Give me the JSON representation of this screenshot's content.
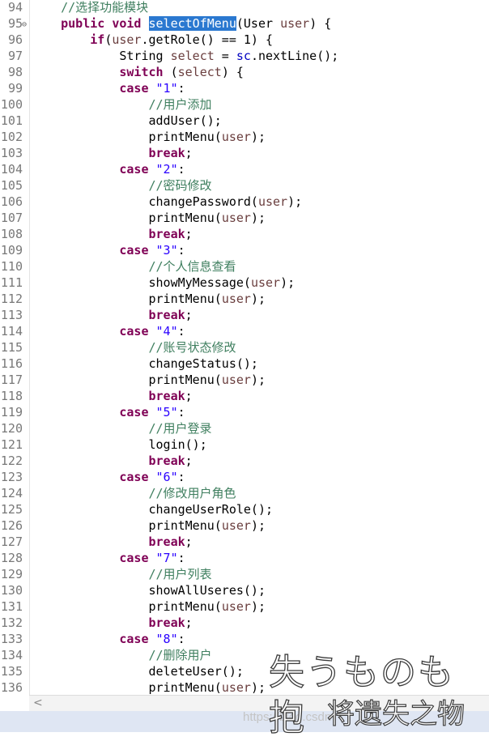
{
  "editor": {
    "lines": [
      {
        "num": "94",
        "fold": "",
        "tokens": [
          {
            "t": "    "
          },
          {
            "t": "//选择功能模块",
            "c": "com"
          }
        ]
      },
      {
        "num": "95",
        "fold": "⊖",
        "tokens": [
          {
            "t": "    "
          },
          {
            "t": "public",
            "c": "kw"
          },
          {
            "t": " "
          },
          {
            "t": "void",
            "c": "kw"
          },
          {
            "t": " "
          },
          {
            "t": "selectOfMenu",
            "c": "sel"
          },
          {
            "t": "(User "
          },
          {
            "t": "user",
            "c": "var"
          },
          {
            "t": ") {"
          }
        ]
      },
      {
        "num": "96",
        "fold": "",
        "tokens": [
          {
            "t": "        "
          },
          {
            "t": "if",
            "c": "kw"
          },
          {
            "t": "("
          },
          {
            "t": "user",
            "c": "var"
          },
          {
            "t": ".getRole() == 1) {"
          }
        ]
      },
      {
        "num": "97",
        "fold": "",
        "tokens": [
          {
            "t": "            String "
          },
          {
            "t": "select",
            "c": "var"
          },
          {
            "t": " = "
          },
          {
            "t": "sc",
            "c": "fld"
          },
          {
            "t": ".nextLine();"
          }
        ]
      },
      {
        "num": "98",
        "fold": "",
        "tokens": [
          {
            "t": "            "
          },
          {
            "t": "switch",
            "c": "kw"
          },
          {
            "t": " ("
          },
          {
            "t": "select",
            "c": "var"
          },
          {
            "t": ") {"
          }
        ]
      },
      {
        "num": "99",
        "fold": "",
        "tokens": [
          {
            "t": "            "
          },
          {
            "t": "case",
            "c": "kw"
          },
          {
            "t": " "
          },
          {
            "t": "\"1\"",
            "c": "str"
          },
          {
            "t": ":"
          }
        ]
      },
      {
        "num": "100",
        "fold": "",
        "tokens": [
          {
            "t": "                "
          },
          {
            "t": "//用户添加",
            "c": "com"
          }
        ]
      },
      {
        "num": "101",
        "fold": "",
        "tokens": [
          {
            "t": "                addUser();"
          }
        ]
      },
      {
        "num": "102",
        "fold": "",
        "tokens": [
          {
            "t": "                printMenu("
          },
          {
            "t": "user",
            "c": "var"
          },
          {
            "t": ");"
          }
        ]
      },
      {
        "num": "103",
        "fold": "",
        "tokens": [
          {
            "t": "                "
          },
          {
            "t": "break",
            "c": "kw"
          },
          {
            "t": ";"
          }
        ]
      },
      {
        "num": "104",
        "fold": "",
        "tokens": [
          {
            "t": "            "
          },
          {
            "t": "case",
            "c": "kw"
          },
          {
            "t": " "
          },
          {
            "t": "\"2\"",
            "c": "str"
          },
          {
            "t": ":"
          }
        ]
      },
      {
        "num": "105",
        "fold": "",
        "tokens": [
          {
            "t": "                "
          },
          {
            "t": "//密码修改",
            "c": "com"
          }
        ]
      },
      {
        "num": "106",
        "fold": "",
        "tokens": [
          {
            "t": "                changePassword("
          },
          {
            "t": "user",
            "c": "var"
          },
          {
            "t": ");"
          }
        ]
      },
      {
        "num": "107",
        "fold": "",
        "tokens": [
          {
            "t": "                printMenu("
          },
          {
            "t": "user",
            "c": "var"
          },
          {
            "t": ");"
          }
        ]
      },
      {
        "num": "108",
        "fold": "",
        "tokens": [
          {
            "t": "                "
          },
          {
            "t": "break",
            "c": "kw"
          },
          {
            "t": ";"
          }
        ]
      },
      {
        "num": "109",
        "fold": "",
        "tokens": [
          {
            "t": "            "
          },
          {
            "t": "case",
            "c": "kw"
          },
          {
            "t": " "
          },
          {
            "t": "\"3\"",
            "c": "str"
          },
          {
            "t": ":"
          }
        ]
      },
      {
        "num": "110",
        "fold": "",
        "tokens": [
          {
            "t": "                "
          },
          {
            "t": "//个人信息查看",
            "c": "com"
          }
        ]
      },
      {
        "num": "111",
        "fold": "",
        "tokens": [
          {
            "t": "                showMyMessage("
          },
          {
            "t": "user",
            "c": "var"
          },
          {
            "t": ");"
          }
        ]
      },
      {
        "num": "112",
        "fold": "",
        "tokens": [
          {
            "t": "                printMenu("
          },
          {
            "t": "user",
            "c": "var"
          },
          {
            "t": ");"
          }
        ]
      },
      {
        "num": "113",
        "fold": "",
        "tokens": [
          {
            "t": "                "
          },
          {
            "t": "break",
            "c": "kw"
          },
          {
            "t": ";"
          }
        ]
      },
      {
        "num": "114",
        "fold": "",
        "tokens": [
          {
            "t": "            "
          },
          {
            "t": "case",
            "c": "kw"
          },
          {
            "t": " "
          },
          {
            "t": "\"4\"",
            "c": "str"
          },
          {
            "t": ":"
          }
        ]
      },
      {
        "num": "115",
        "fold": "",
        "tokens": [
          {
            "t": "                "
          },
          {
            "t": "//账号状态修改",
            "c": "com"
          }
        ]
      },
      {
        "num": "116",
        "fold": "",
        "tokens": [
          {
            "t": "                changeStatus();"
          }
        ]
      },
      {
        "num": "117",
        "fold": "",
        "tokens": [
          {
            "t": "                printMenu("
          },
          {
            "t": "user",
            "c": "var"
          },
          {
            "t": ");"
          }
        ]
      },
      {
        "num": "118",
        "fold": "",
        "tokens": [
          {
            "t": "                "
          },
          {
            "t": "break",
            "c": "kw"
          },
          {
            "t": ";"
          }
        ]
      },
      {
        "num": "119",
        "fold": "",
        "tokens": [
          {
            "t": "            "
          },
          {
            "t": "case",
            "c": "kw"
          },
          {
            "t": " "
          },
          {
            "t": "\"5\"",
            "c": "str"
          },
          {
            "t": ":"
          }
        ]
      },
      {
        "num": "120",
        "fold": "",
        "tokens": [
          {
            "t": "                "
          },
          {
            "t": "//用户登录",
            "c": "com"
          }
        ]
      },
      {
        "num": "121",
        "fold": "",
        "tokens": [
          {
            "t": "                login();"
          }
        ]
      },
      {
        "num": "122",
        "fold": "",
        "tokens": [
          {
            "t": "                "
          },
          {
            "t": "break",
            "c": "kw"
          },
          {
            "t": ";"
          }
        ]
      },
      {
        "num": "123",
        "fold": "",
        "tokens": [
          {
            "t": "            "
          },
          {
            "t": "case",
            "c": "kw"
          },
          {
            "t": " "
          },
          {
            "t": "\"6\"",
            "c": "str"
          },
          {
            "t": ":"
          }
        ]
      },
      {
        "num": "124",
        "fold": "",
        "tokens": [
          {
            "t": "                "
          },
          {
            "t": "//修改用户角色",
            "c": "com"
          }
        ]
      },
      {
        "num": "125",
        "fold": "",
        "tokens": [
          {
            "t": "                changeUserRole();"
          }
        ]
      },
      {
        "num": "126",
        "fold": "",
        "tokens": [
          {
            "t": "                printMenu("
          },
          {
            "t": "user",
            "c": "var"
          },
          {
            "t": ");"
          }
        ]
      },
      {
        "num": "127",
        "fold": "",
        "tokens": [
          {
            "t": "                "
          },
          {
            "t": "break",
            "c": "kw"
          },
          {
            "t": ";"
          }
        ]
      },
      {
        "num": "128",
        "fold": "",
        "tokens": [
          {
            "t": "            "
          },
          {
            "t": "case",
            "c": "kw"
          },
          {
            "t": " "
          },
          {
            "t": "\"7\"",
            "c": "str"
          },
          {
            "t": ":"
          }
        ]
      },
      {
        "num": "129",
        "fold": "",
        "tokens": [
          {
            "t": "                "
          },
          {
            "t": "//用户列表",
            "c": "com"
          }
        ]
      },
      {
        "num": "130",
        "fold": "",
        "tokens": [
          {
            "t": "                showAllUseres();"
          }
        ]
      },
      {
        "num": "131",
        "fold": "",
        "tokens": [
          {
            "t": "                printMenu("
          },
          {
            "t": "user",
            "c": "var"
          },
          {
            "t": ");"
          }
        ]
      },
      {
        "num": "132",
        "fold": "",
        "tokens": [
          {
            "t": "                "
          },
          {
            "t": "break",
            "c": "kw"
          },
          {
            "t": ";"
          }
        ]
      },
      {
        "num": "133",
        "fold": "",
        "tokens": [
          {
            "t": "            "
          },
          {
            "t": "case",
            "c": "kw"
          },
          {
            "t": " "
          },
          {
            "t": "\"8\"",
            "c": "str"
          },
          {
            "t": ":"
          }
        ]
      },
      {
        "num": "134",
        "fold": "",
        "tokens": [
          {
            "t": "                "
          },
          {
            "t": "//删除用户",
            "c": "com"
          }
        ]
      },
      {
        "num": "135",
        "fold": "",
        "tokens": [
          {
            "t": "                deleteUser();"
          }
        ]
      },
      {
        "num": "136",
        "fold": "",
        "tokens": [
          {
            "t": "                printMenu("
          },
          {
            "t": "user",
            "c": "var"
          },
          {
            "t": ");"
          }
        ]
      }
    ]
  },
  "scrollbar": {
    "left_arrow": "<",
    "icon": "chevron-left-icon"
  },
  "watermark": {
    "url": "https://blog.csdn",
    "line1": "失うものも抱",
    "line2": "将遗失之物"
  },
  "colors": {
    "keyword": "#7f0055",
    "comment": "#3f7f5f",
    "string": "#2a00ff",
    "local_variable": "#6a3e3e",
    "field": "#0000c0",
    "selection": "#2a78d0",
    "line_number": "#787878",
    "status_bar": "#dfe6f3"
  }
}
